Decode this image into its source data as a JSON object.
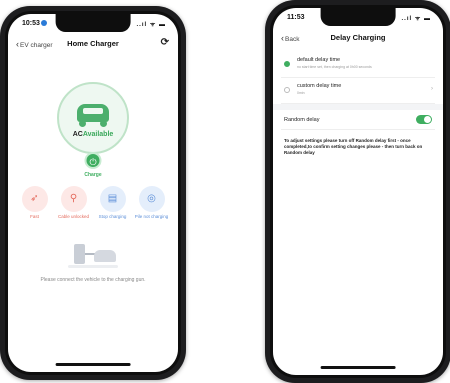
{
  "left": {
    "status": {
      "time": "10:53",
      "icons": "..ıl ᯤ ▬"
    },
    "nav": {
      "back": "EV charger",
      "title": "Home Charger",
      "refresh_glyph": "⟳"
    },
    "charger": {
      "ac": "AC",
      "availability": "Available",
      "charge_label": "Charge",
      "charge_glyph": "⏻"
    },
    "actions": [
      {
        "label": "Fast",
        "glyph": "➶",
        "icon": "rocket-icon"
      },
      {
        "label": "Cable unlocked",
        "glyph": "⚲",
        "icon": "unlock-icon"
      },
      {
        "label": "Stop charging",
        "glyph": "▤",
        "icon": "stop-charging-icon"
      },
      {
        "label": "Pile not charging",
        "glyph": "◎",
        "icon": "pile-icon"
      }
    ],
    "hint": "Please connect the vehicle to the charging gun."
  },
  "right": {
    "status": {
      "time": "11:53",
      "icons": "..ıl ᯤ ▬"
    },
    "nav": {
      "back": "Back",
      "title": "Delay Charging"
    },
    "options": [
      {
        "title": "default delay time",
        "sub": "no start time set, then charging at 0h00 seconds",
        "selected": true
      },
      {
        "title": "custom delay time",
        "sub": "0min",
        "selected": false
      }
    ],
    "random_delay": {
      "label": "Random delay",
      "on": true
    },
    "notice": "To adjust settings please turn off Random delay first - once completed,to confirm setting changes please - then turn back on Random delay"
  },
  "colors": {
    "accent": "#3fae60",
    "alert": "#e46a5c",
    "info": "#5d8fd8"
  }
}
